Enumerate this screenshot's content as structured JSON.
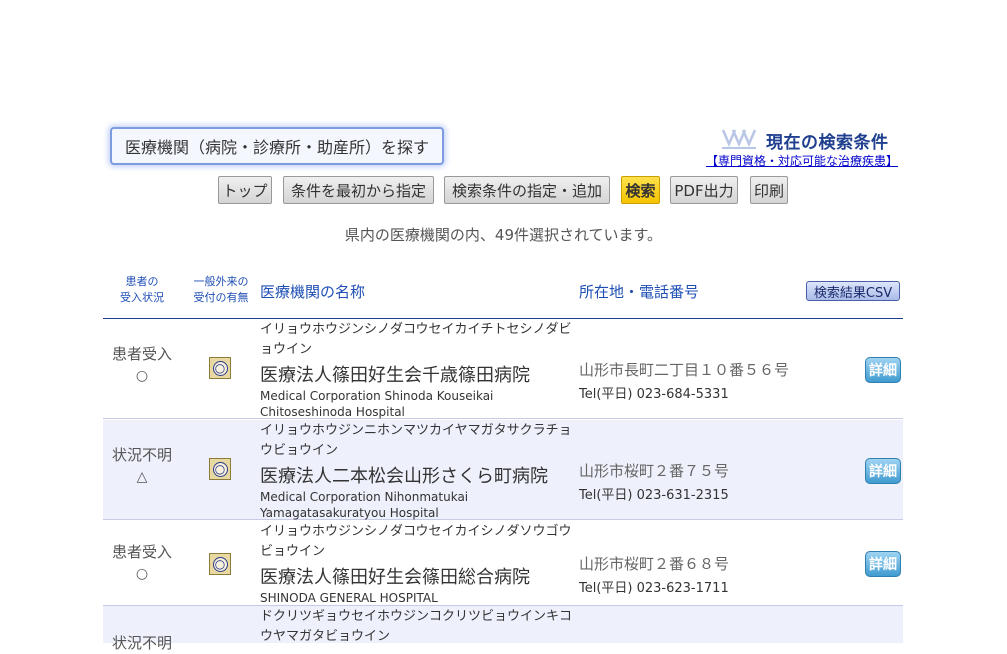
{
  "search": {
    "title": "医療機関（病院・診療所・助産所）を探す",
    "conditions_title": "現在の検索条件",
    "conditions_link": "【専門資格・対応可能な治療疾患】"
  },
  "toolbar": {
    "buttons": [
      "トップ",
      "条件を最初から指定",
      "検索条件の指定・追加",
      "検索",
      "PDF出力",
      "印刷"
    ]
  },
  "result": {
    "message": "県内の医療機関の内、49件選択されています。"
  },
  "table": {
    "headers": {
      "acceptance": "患者の\n受入状況",
      "outpatient": "一般外来の\n受付の有無",
      "name": "医療機関の名称",
      "address": "所在地・電話番号",
      "csv_button": "検索結果CSV"
    },
    "rows": [
      {
        "status": "患者受入",
        "status_mark": "○",
        "outpatient_mark": "○",
        "kana": "イリョウホウジンシノダコウセイカイチトセシノダビョウイン",
        "name": "医療法人篠田好生会千歳篠田病院",
        "english": "Medical Corporation Shinoda Kouseikai Chitoseshinoda Hospital",
        "address": "山形市長町二丁目１０番５６号",
        "tel": "Tel(平日) 023-684-5331",
        "detail": "詳細"
      },
      {
        "status": "状況不明",
        "status_mark": "△",
        "outpatient_mark": "○",
        "kana": "イリョウホウジンニホンマツカイヤマガタサクラチョウビョウイン",
        "name": "医療法人二本松会山形さくら町病院",
        "english": "Medical Corporation Nihonmatukai Yamagatasakuratyou Hospital",
        "address": "山形市桜町２番７５号",
        "tel": "Tel(平日) 023-631-2315",
        "detail": "詳細"
      },
      {
        "status": "患者受入",
        "status_mark": "○",
        "outpatient_mark": "○",
        "kana": "イリョウホウジンシノダコウセイカイシノダソウゴウビョウイン",
        "name": "医療法人篠田好生会篠田総合病院",
        "english": "SHINODA GENERAL HOSPITAL",
        "address": "山形市桜町２番６８号",
        "tel": "Tel(平日) 023-623-1711",
        "detail": "詳細"
      },
      {
        "status": "状況不明",
        "kana": "ドクリツギョウセイホウジンコクリツビョウインキコウヤマガタビョウイン"
      }
    ]
  }
}
